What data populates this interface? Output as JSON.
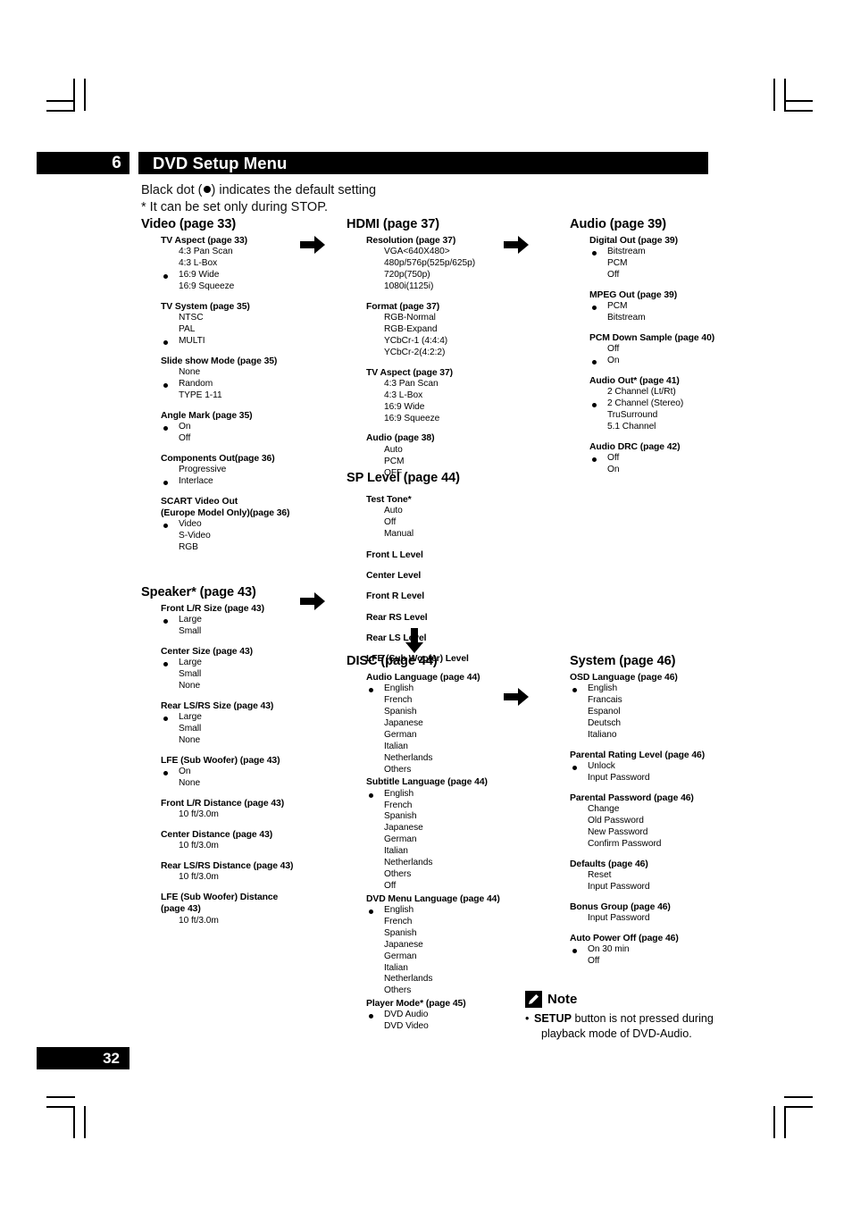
{
  "header": {
    "chapter_number": "6",
    "title": "DVD Setup Menu",
    "page_number": "32"
  },
  "intro": {
    "line1_before": "Black dot (",
    "line1_after": ") indicates the default setting",
    "line2": "* It can be set only during STOP."
  },
  "sections": {
    "video": {
      "title": "Video  (page 33)",
      "groups": [
        {
          "title": "TV Aspect  (page 33)",
          "options": [
            {
              "label": "4:3 Pan Scan",
              "default": false
            },
            {
              "label": "4:3 L-Box",
              "default": false
            },
            {
              "label": "16:9 Wide",
              "default": true
            },
            {
              "label": "16:9 Squeeze",
              "default": false
            }
          ]
        },
        {
          "title": "TV System (page 35)",
          "options": [
            {
              "label": "NTSC",
              "default": false
            },
            {
              "label": "PAL",
              "default": false
            },
            {
              "label": "MULTI",
              "default": true
            }
          ]
        },
        {
          "title": "Slide show Mode (page 35)",
          "options": [
            {
              "label": "None",
              "default": false
            },
            {
              "label": "Random",
              "default": true
            },
            {
              "label": "TYPE 1-11",
              "default": false
            }
          ]
        },
        {
          "title": "Angle Mark (page 35)",
          "options": [
            {
              "label": "On",
              "default": true
            },
            {
              "label": "Off",
              "default": false
            }
          ]
        },
        {
          "title": "Components Out(page 36)",
          "options": [
            {
              "label": "Progressive",
              "default": false
            },
            {
              "label": "Interlace",
              "default": true
            }
          ]
        },
        {
          "title": "SCART Video Out",
          "title2": "(Europe Model Only)(page 36)",
          "options": [
            {
              "label": "Video",
              "default": true
            },
            {
              "label": "S-Video",
              "default": false
            },
            {
              "label": "RGB",
              "default": false
            }
          ]
        }
      ]
    },
    "hdmi": {
      "title": "HDMI (page 37)",
      "groups": [
        {
          "title": "Resolution (page 37)",
          "options": [
            {
              "label": "VGA<640X480>",
              "default": false
            },
            {
              "label": "480p/576p(525p/625p)",
              "default": false
            },
            {
              "label": "720p(750p)",
              "default": false
            },
            {
              "label": "1080i(1125i)",
              "default": false
            }
          ]
        },
        {
          "title": "Format (page 37)",
          "options": [
            {
              "label": "RGB-Normal",
              "default": false
            },
            {
              "label": "RGB-Expand",
              "default": false
            },
            {
              "label": "YCbCr-1 (4:4:4)",
              "default": false
            },
            {
              "label": "YCbCr-2(4:2:2)",
              "default": false
            }
          ]
        },
        {
          "title": "TV Aspect  (page 37)",
          "options": [
            {
              "label": "4:3 Pan Scan",
              "default": false
            },
            {
              "label": "4:3 L-Box",
              "default": false
            },
            {
              "label": "16:9 Wide",
              "default": false
            },
            {
              "label": "16:9 Squeeze",
              "default": false
            }
          ]
        },
        {
          "title": "Audio (page 38)",
          "options": [
            {
              "label": "Auto",
              "default": false
            },
            {
              "label": "PCM",
              "default": false
            },
            {
              "label": "OFF",
              "default": false
            }
          ]
        }
      ]
    },
    "audio": {
      "title": "Audio (page 39)",
      "groups": [
        {
          "title": "Digital Out (page 39)",
          "options": [
            {
              "label": "Bitstream",
              "default": true
            },
            {
              "label": "PCM",
              "default": false
            },
            {
              "label": "Off",
              "default": false
            }
          ]
        },
        {
          "title": "MPEG Out (page 39)",
          "options": [
            {
              "label": "PCM",
              "default": true
            },
            {
              "label": "Bitstream",
              "default": false
            }
          ]
        },
        {
          "title": "PCM Down Sample (page 40)",
          "options": [
            {
              "label": "Off",
              "default": false
            },
            {
              "label": "On",
              "default": true
            }
          ]
        },
        {
          "title": "Audio Out* (page 41)",
          "options": [
            {
              "label": "2 Channel (Lt/Rt)",
              "default": false
            },
            {
              "label": "2 Channel (Stereo)",
              "default": true
            },
            {
              "label": "TruSurround",
              "default": false
            },
            {
              "label": "5.1 Channel",
              "default": false
            }
          ]
        },
        {
          "title": "Audio DRC  (page 42)",
          "options": [
            {
              "label": "Off",
              "default": true
            },
            {
              "label": "On",
              "default": false
            }
          ]
        }
      ]
    },
    "sp_level": {
      "title": "SP Level (page 44)",
      "groups": [
        {
          "title": "Test Tone*",
          "options": [
            {
              "label": "Auto",
              "default": false
            },
            {
              "label": "Off",
              "default": false
            },
            {
              "label": "Manual",
              "default": false
            }
          ]
        },
        {
          "title": "Front L Level",
          "options": []
        },
        {
          "title": "Center Level",
          "options": []
        },
        {
          "title": "Front R Level",
          "options": []
        },
        {
          "title": "Rear RS Level",
          "options": []
        },
        {
          "title": "Rear LS Level",
          "options": []
        },
        {
          "title": "LFE (Sub Woofer) Level",
          "options": []
        }
      ]
    },
    "speaker": {
      "title": "Speaker* (page 43)",
      "groups": [
        {
          "title": "Front L/R Size (page 43)",
          "options": [
            {
              "label": "Large",
              "default": true
            },
            {
              "label": "Small",
              "default": false
            }
          ]
        },
        {
          "title": "Center Size (page 43)",
          "options": [
            {
              "label": "Large",
              "default": true
            },
            {
              "label": "Small",
              "default": false
            },
            {
              "label": "None",
              "default": false
            }
          ]
        },
        {
          "title": "Rear LS/RS Size (page 43)",
          "options": [
            {
              "label": "Large",
              "default": true
            },
            {
              "label": "Small",
              "default": false
            },
            {
              "label": "None",
              "default": false
            }
          ]
        },
        {
          "title": "LFE (Sub Woofer) (page 43)",
          "options": [
            {
              "label": "On",
              "default": true
            },
            {
              "label": "None",
              "default": false
            }
          ]
        },
        {
          "title": "Front L/R Distance (page 43)",
          "options": [
            {
              "label": "10 ft/3.0m",
              "default": false
            }
          ]
        },
        {
          "title": "Center Distance (page 43)",
          "options": [
            {
              "label": "10 ft/3.0m",
              "default": false
            }
          ]
        },
        {
          "title": "Rear LS/RS Distance (page 43)",
          "options": [
            {
              "label": "10 ft/3.0m",
              "default": false
            }
          ]
        },
        {
          "title": "LFE (Sub Woofer) Distance",
          "title2": "(page 43)",
          "options": [
            {
              "label": "10 ft/3.0m",
              "default": false
            }
          ]
        }
      ]
    },
    "disc": {
      "title": "DISC (page 44)",
      "groups": [
        {
          "title": "Audio Language (page 44)",
          "options": [
            {
              "label": "English",
              "default": true
            },
            {
              "label": "French",
              "default": false
            },
            {
              "label": "Spanish",
              "default": false
            },
            {
              "label": "Japanese",
              "default": false
            },
            {
              "label": "German",
              "default": false
            },
            {
              "label": "Italian",
              "default": false
            },
            {
              "label": "Netherlands",
              "default": false
            },
            {
              "label": "Others",
              "default": false
            }
          ]
        },
        {
          "title": "Subtitle Language (page 44)",
          "options": [
            {
              "label": "English",
              "default": true
            },
            {
              "label": "French",
              "default": false
            },
            {
              "label": "Spanish",
              "default": false
            },
            {
              "label": "Japanese",
              "default": false
            },
            {
              "label": "German",
              "default": false
            },
            {
              "label": "Italian",
              "default": false
            },
            {
              "label": "Netherlands",
              "default": false
            },
            {
              "label": "Others",
              "default": false
            },
            {
              "label": "Off",
              "default": false
            }
          ]
        },
        {
          "title": "DVD Menu Language (page 44)",
          "options": [
            {
              "label": "English",
              "default": true
            },
            {
              "label": "French",
              "default": false
            },
            {
              "label": "Spanish",
              "default": false
            },
            {
              "label": "Japanese",
              "default": false
            },
            {
              "label": "German",
              "default": false
            },
            {
              "label": "Italian",
              "default": false
            },
            {
              "label": "Netherlands",
              "default": false
            },
            {
              "label": "Others",
              "default": false
            }
          ]
        },
        {
          "title": "Player Mode* (page 45)",
          "options": [
            {
              "label": "DVD Audio",
              "default": true
            },
            {
              "label": "DVD Video",
              "default": false
            }
          ]
        }
      ]
    },
    "system": {
      "title": "System (page 46)",
      "groups": [
        {
          "title": "OSD Language (page 46)",
          "options": [
            {
              "label": "English",
              "default": true
            },
            {
              "label": "Francais",
              "default": false
            },
            {
              "label": "Espanol",
              "default": false
            },
            {
              "label": "Deutsch",
              "default": false
            },
            {
              "label": "Italiano",
              "default": false
            }
          ]
        },
        {
          "title": "Parental Rating Level (page 46)",
          "options": [
            {
              "label": "Unlock",
              "default": true
            },
            {
              "label": "Input Password",
              "default": false
            }
          ]
        },
        {
          "title": "Parental Password (page 46)",
          "options": [
            {
              "label": "Change",
              "default": false
            },
            {
              "label": "Old Password",
              "default": false
            },
            {
              "label": "New Password",
              "default": false
            },
            {
              "label": "Confirm Password",
              "default": false
            }
          ]
        },
        {
          "title": "Defaults (page 46)",
          "options": [
            {
              "label": "Reset",
              "default": false
            },
            {
              "label": "Input Password",
              "default": false
            }
          ]
        },
        {
          "title": "Bonus Group (page 46)",
          "options": [
            {
              "label": "Input Password",
              "default": false
            }
          ]
        },
        {
          "title": "Auto Power Off (page 46)",
          "options": [
            {
              "label": "On 30 min",
              "default": true
            },
            {
              "label": "Off",
              "default": false
            }
          ]
        }
      ]
    }
  },
  "note": {
    "title": "Note",
    "bullet_bold": "SETUP",
    "bullet_text": " button is not pressed during",
    "bullet_text2": "playback mode of DVD-Audio."
  }
}
